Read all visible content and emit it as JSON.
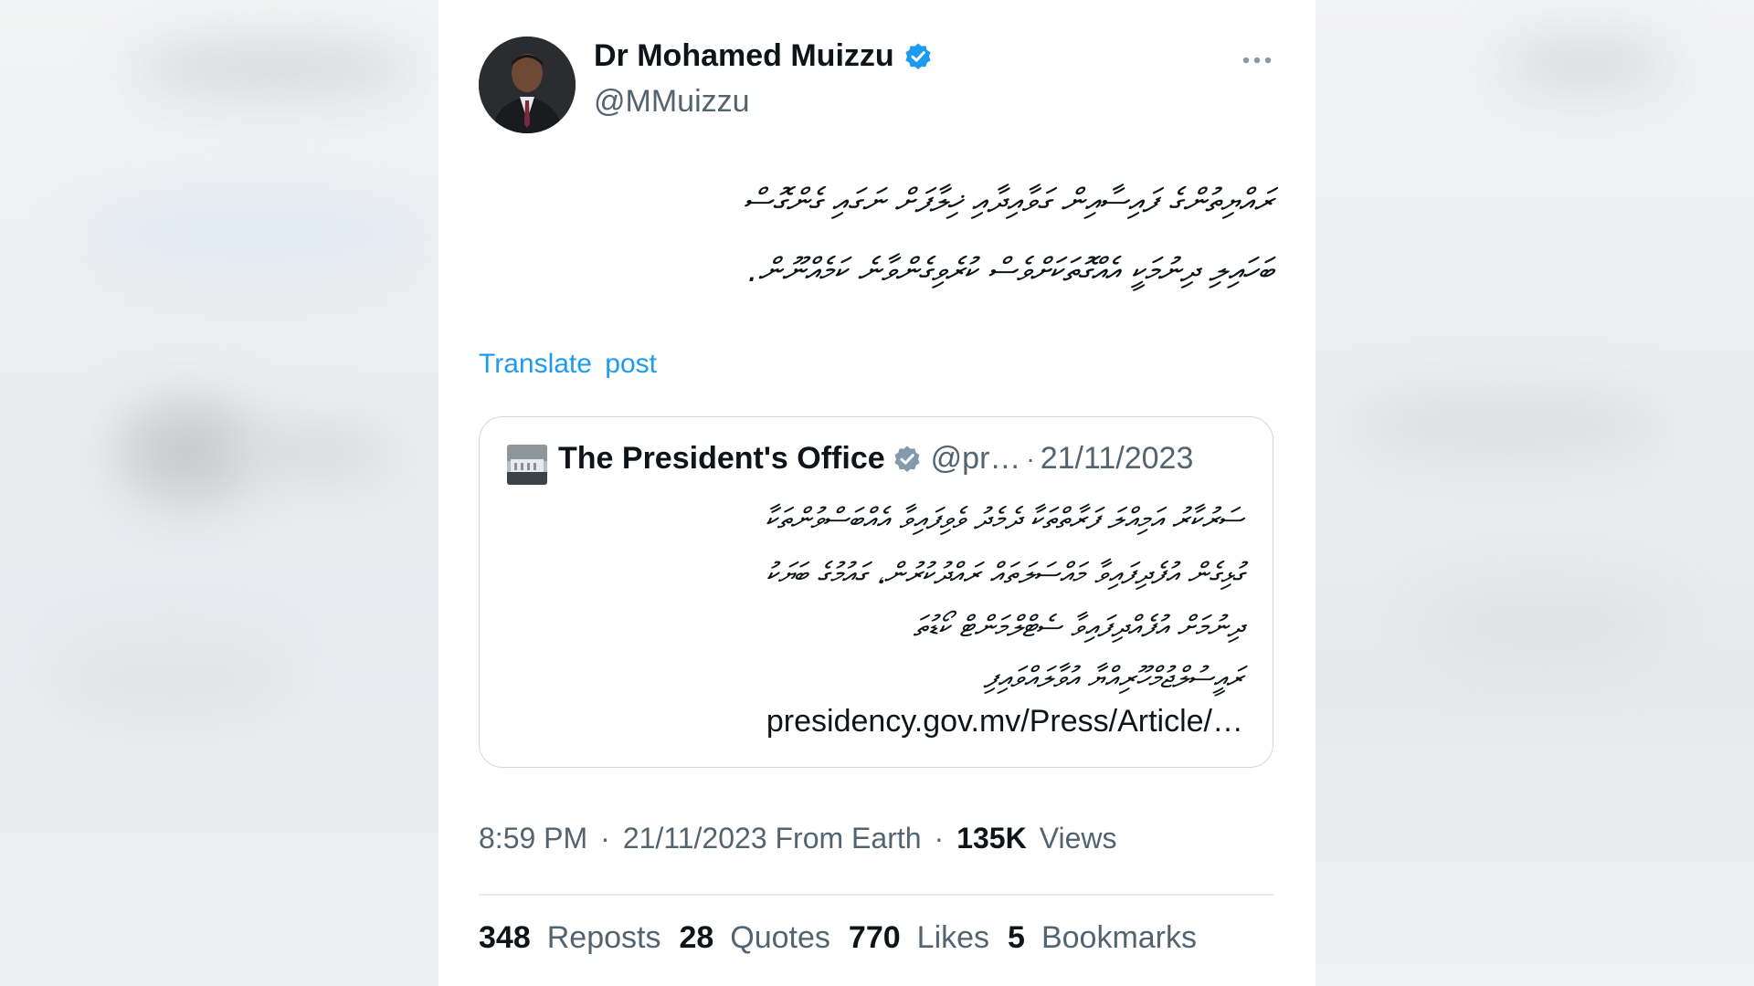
{
  "post": {
    "author_name": "Dr Mohamed Muizzu",
    "author_handle": "@MMuizzu",
    "body_lines": [
      "ރައްޔިތުންގެ ފައިސާއިން ގަވާއިދާއި ޚިލާފަށް ނަގައި ގެންގޮސް",
      "ބަހައިލި ދިނުމަކީ އެއްގޮތަކަށްވެސް ކުރެވިގެންވާނެ ކަމެއްނޫން."
    ],
    "translate_label": "Translate post",
    "time": "8:59 PM",
    "date_source": "21/11/2023 From  Earth",
    "separator": "·",
    "views_count": "135K",
    "views_label": "Views"
  },
  "quote": {
    "name": "The President's Office",
    "handle": "@pr…",
    "separator": "·",
    "date": "21/11/2023",
    "lines": [
      "ސަރުކާރު އަމިއްލަ ފަރާތްތަކާ ދެމެދު ވެވިފައިވާ އެއްބަސްވުންތަކާ",
      "ގުޅިގެން އުފެދިފައިވާ މައްސަލަތައް ރައްދުކުރުން، ގައުމުގެ ބަޔަކު",
      "ދިނުމަށް އުފެއްދިފައިވާ ސެޓްލްމަންޓް ކޯޑުތަ",
      "ރައީސުލްޖުމްހޫރިއްޔާ އުވާލައްވައިފި"
    ],
    "link": "presidency.gov.mv/Press/Article/…"
  },
  "stats": [
    {
      "count": "348",
      "label": "Reposts"
    },
    {
      "count": "28",
      "label": "Quotes"
    },
    {
      "count": "770",
      "label": "Likes"
    },
    {
      "count": "5",
      "label": "Bookmarks"
    }
  ],
  "icons": {
    "verified": "verified-badge-icon",
    "more": "more-horizontal-icon"
  },
  "colors": {
    "verified_blue": "#1d9bf0",
    "verified_gray": "#829aab",
    "link_blue": "#1d9bf0",
    "text_primary": "#0f1419",
    "text_secondary": "#536471",
    "border": "#cfd9de"
  }
}
